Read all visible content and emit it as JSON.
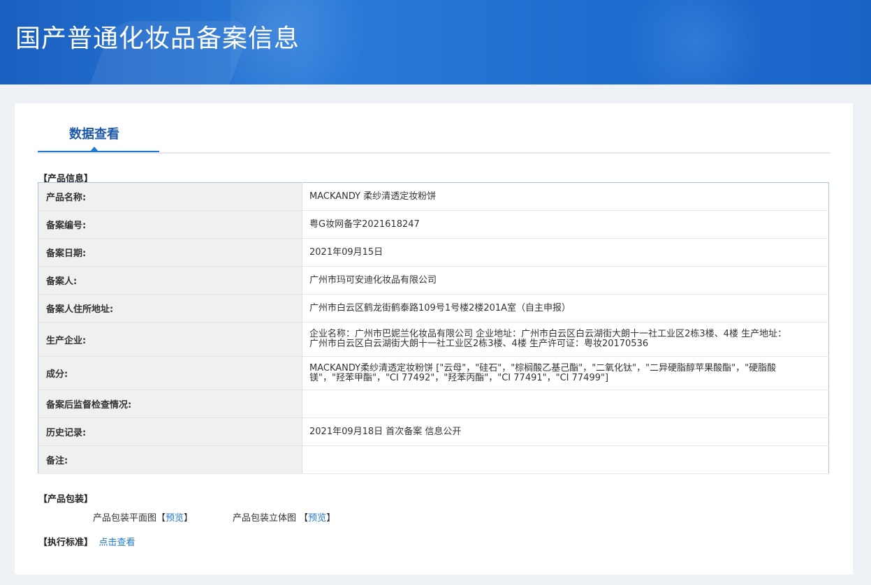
{
  "header": {
    "title": "国产普通化妆品备案信息"
  },
  "tabs": [
    {
      "label": "数据查看"
    }
  ],
  "product_info": {
    "section_title": "【产品信息】",
    "rows": [
      {
        "label": "产品名称:",
        "value": "MACKANDY 柔纱清透定妆粉饼"
      },
      {
        "label": "备案编号:",
        "value": "粤G妆网备字2021618247"
      },
      {
        "label": "备案日期:",
        "value": "2021年09月15日"
      },
      {
        "label": "备案人:",
        "value": "广州市玛可安迪化妆品有限公司"
      },
      {
        "label": "备案人住所地址:",
        "value": "广州市白云区鹤龙街鹤泰路109号1号楼2楼201A室（自主申报）"
      },
      {
        "label": "生产企业:",
        "value": "企业名称：广州市巴妮兰化妆品有限公司 企业地址：广州市白云区白云湖街大朗十一社工业区2栋3楼、4楼 生产地址：广州市白云区白云湖街大朗十一社工业区2栋3楼、4楼 生产许可证：粤妆20170536"
      },
      {
        "label": "成分:",
        "value": "MACKANDY柔纱清透定妆粉饼 [\"云母\"，\"硅石\"，\"棕榈酸乙基己酯\"，\"二氧化钛\"，\"二异硬脂醇苹果酸酯\"，\"硬脂酸镁\"，\"羟苯甲酯\"，\"CI 77492\"，\"羟苯丙酯\"，\"CI 77491\"，\"CI 77499\"]"
      },
      {
        "label": "备案后监督检查情况:",
        "value": ""
      },
      {
        "label": "历史记录:",
        "value": "2021年09月18日 首次备案 信息公开"
      },
      {
        "label": "备注:",
        "value": ""
      }
    ]
  },
  "packaging": {
    "section_title": "【产品包装】",
    "flat": {
      "label": "产品包装平面图",
      "bracket_open": "【",
      "link": "预览",
      "bracket_close": "】"
    },
    "solid": {
      "label": "产品包装立体图",
      "bracket_open": "【",
      "link": "预览",
      "bracket_close": "】"
    }
  },
  "standard": {
    "section_title": "【执行标准】",
    "link": "点击查看"
  },
  "colors": {
    "banner": "#1f6fd0",
    "accent": "#1f79d0",
    "tab_text": "#1f5aa8",
    "border": "#a9c4e2"
  }
}
